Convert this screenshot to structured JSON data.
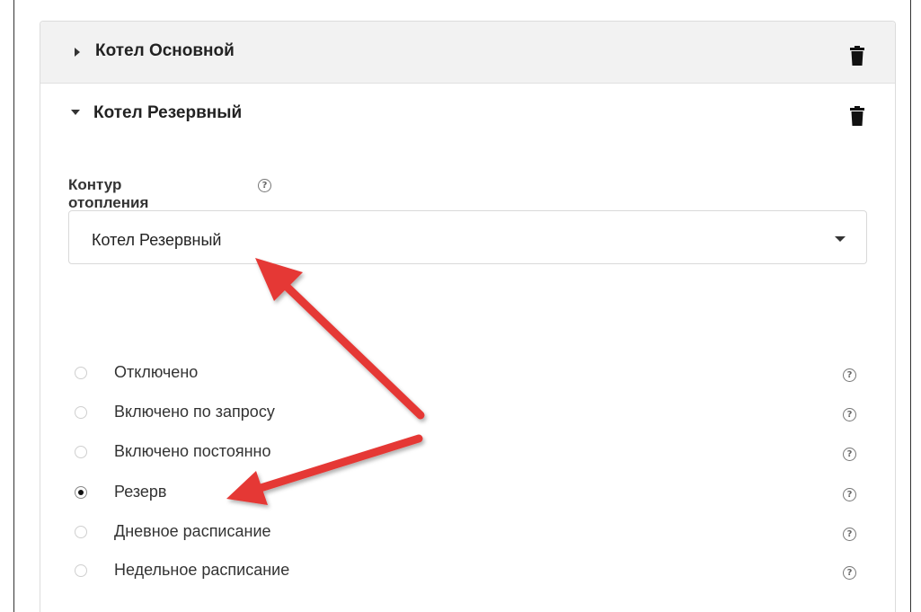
{
  "accordion": {
    "items": [
      {
        "title": "Котел Основной",
        "expanded": false,
        "delete_icon": "trash-icon"
      },
      {
        "title": "Котел Резервный",
        "expanded": true,
        "delete_icon": "trash-icon"
      }
    ]
  },
  "heating_circuit": {
    "label": "Контур отопления",
    "help_icon": "question-circle-icon",
    "selected": "Котел Резервный"
  },
  "mode_options": [
    {
      "label": "Отключено",
      "checked": false
    },
    {
      "label": "Включено по запросу",
      "checked": false
    },
    {
      "label": "Включено постоянно",
      "checked": false
    },
    {
      "label": "Резерв",
      "checked": true
    },
    {
      "label": "Дневное расписание",
      "checked": false
    },
    {
      "label": "Недельное расписание",
      "checked": false
    }
  ],
  "help_glyph": "?",
  "colors": {
    "annotation_arrow": "#e53935",
    "header_bg": "#f2f2f2",
    "text": "#333333"
  }
}
